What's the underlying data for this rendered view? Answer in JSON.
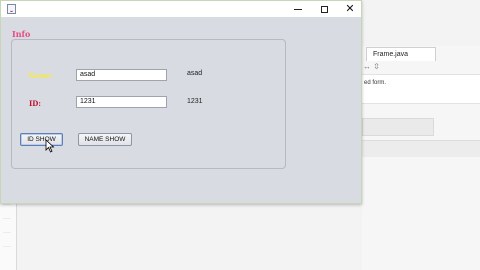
{
  "ide": {
    "tab_label": "Frame.java",
    "tab_icons": "↔ ⇳",
    "editor_text": "ed form."
  },
  "window": {
    "title": "",
    "controls": {
      "minimize": "",
      "maximize": "",
      "close": "✕"
    },
    "group_title": "Info",
    "name": {
      "label": "Name:",
      "input_value": "asad",
      "output_text": "asad"
    },
    "id": {
      "label": "ID:",
      "input_value": "1231",
      "output_text": "1231"
    },
    "buttons": {
      "id_show": "ID SHOW",
      "name_show": "NAME SHOW"
    }
  },
  "colors": {
    "group_title": "#e84a80",
    "name_label": "#f4e94a",
    "id_label": "#c0102e",
    "window_bg": "#d9dbe2"
  }
}
